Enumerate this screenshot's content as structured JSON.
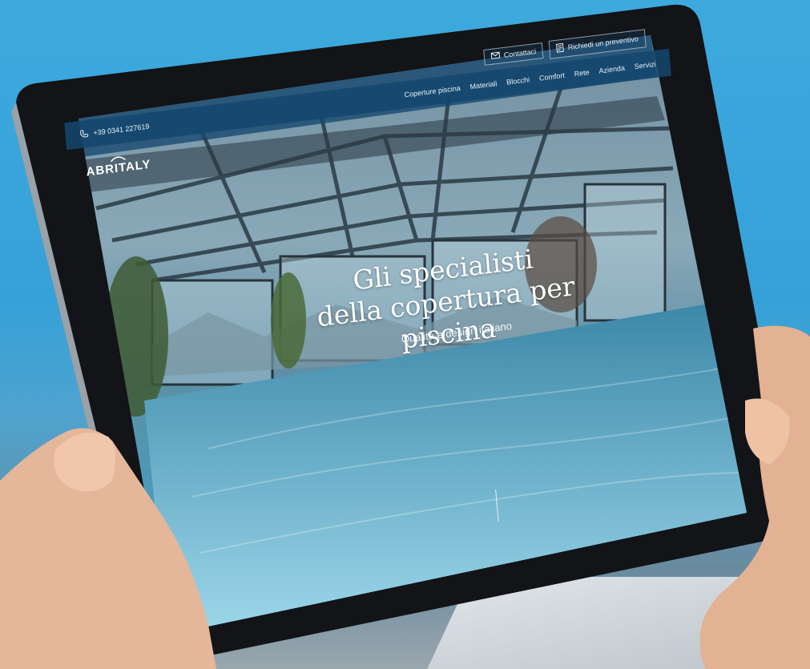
{
  "top_actions": {
    "contact_label": "Contattaci",
    "quote_label": "Richiedi un preventivo"
  },
  "nav": {
    "phone": "+39 0341 227619",
    "menu": [
      "Coperture piscina",
      "Materiali",
      "Blocchi",
      "Comfort",
      "Rete",
      "Azienda",
      "Servizi"
    ]
  },
  "logo": {
    "text": "ABRITALY"
  },
  "hero": {
    "title_line1": "Gli specialisti",
    "title_line2": "della copertura per piscina",
    "subtitle": "Qualità e design italiano"
  },
  "colors": {
    "nav_bg": "#14466e",
    "sky": "#3ea9dd",
    "pool": "#4fa6c6"
  },
  "icons": {
    "phone": "phone-icon",
    "mail": "mail-icon",
    "quote": "document-icon"
  }
}
